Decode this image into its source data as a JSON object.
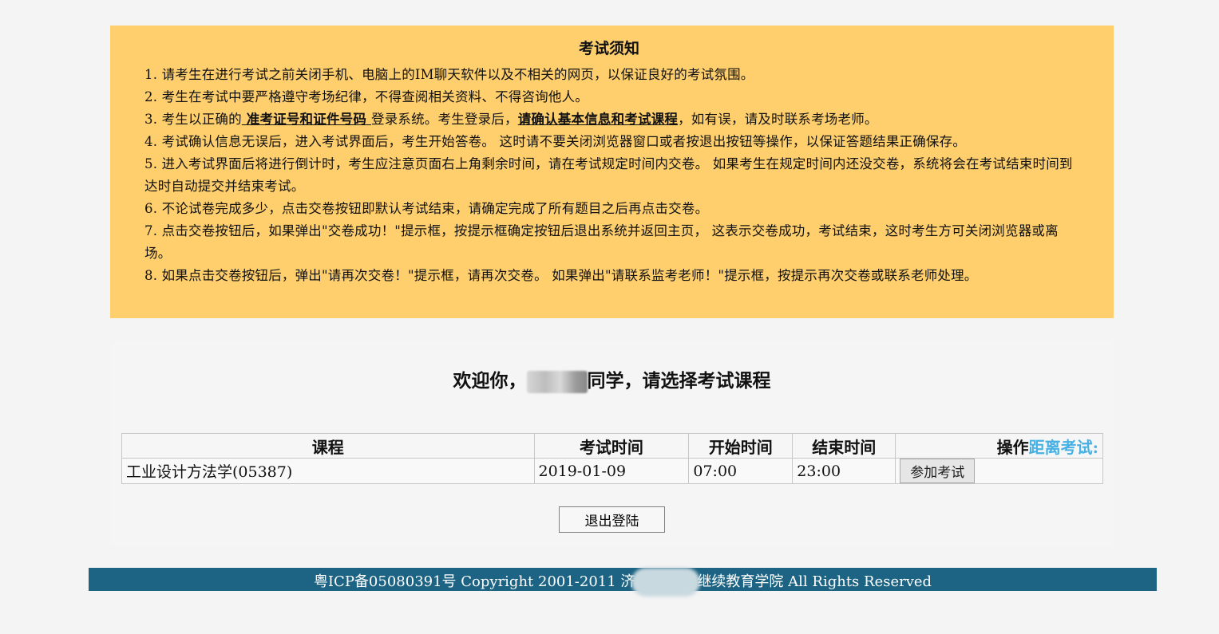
{
  "notice": {
    "title": "考试须知",
    "items": [
      "1. 请考生在进行考试之前关闭手机、电脑上的IM聊天软件以及不相关的网页，以保证良好的考试氛围。",
      "2. 考生在考试中要严格遵守考场纪律，不得查阅相关资料、不得咨询他人。",
      "5. 进入考试界面后将进行倒计时，考生应注意页面右上角剩余时间，请在考试规定时间内交卷。 如果考生在规定时间内还没交卷，系统将会在考试结束时间到达时自动提交并结束考试。",
      "6. 不论试卷完成多少，点击交卷按钮即默认考试结束，请确定完成了所有题目之后再点击交卷。",
      "7. 点击交卷按钮后，如果弹出\"交卷成功！\"提示框，按提示框确定按钮后退出系统并返回主页， 这表示交卷成功，考试结束，这时考生方可关闭浏览器或离场。",
      "8. 如果点击交卷按钮后，弹出\"请再次交卷！\"提示框，请再次交卷。 如果弹出\"请联系监考老师！\"提示框，按提示再次交卷或联系老师处理。"
    ],
    "item3": {
      "prefix": "3. 考生以正确的",
      "strong1": " 准考证号和证件号码 ",
      "middle": "登录系统。考生登录后，",
      "strong2": "请确认基本信息和考试课程",
      "suffix": "，如有误，请及时联系考场老师。"
    },
    "item4": "4. 考试确认信息无误后，进入考试界面后，考生开始答卷。 这时请不要关闭浏览器窗口或者按退出按钮等操作，以保证答题结果正确保存。"
  },
  "welcome": {
    "prefix": "欢迎你，",
    "suffix": "同学，请选择考试课程"
  },
  "table": {
    "headers": {
      "course": "课程",
      "exam_time": "考试时间",
      "start_time": "开始时间",
      "end_time": "结束时间",
      "operation": "操作",
      "countdown": "距离考试:"
    },
    "rows": [
      {
        "course": "工业设计方法学(05387)",
        "exam_time": "2019-01-09",
        "start_time": "07:00",
        "end_time": "23:00",
        "action": "参加考试"
      }
    ]
  },
  "logout_label": "退出登陆",
  "footer": {
    "left": "粤ICP备05080391号  Copyright 2001-2011 济",
    "right": "继续教育学院 All Rights Reserved"
  },
  "colors": {
    "notice_bg": "#ffcf6e",
    "footer_bg": "#1d6383",
    "countdown": "#48b1e3"
  }
}
